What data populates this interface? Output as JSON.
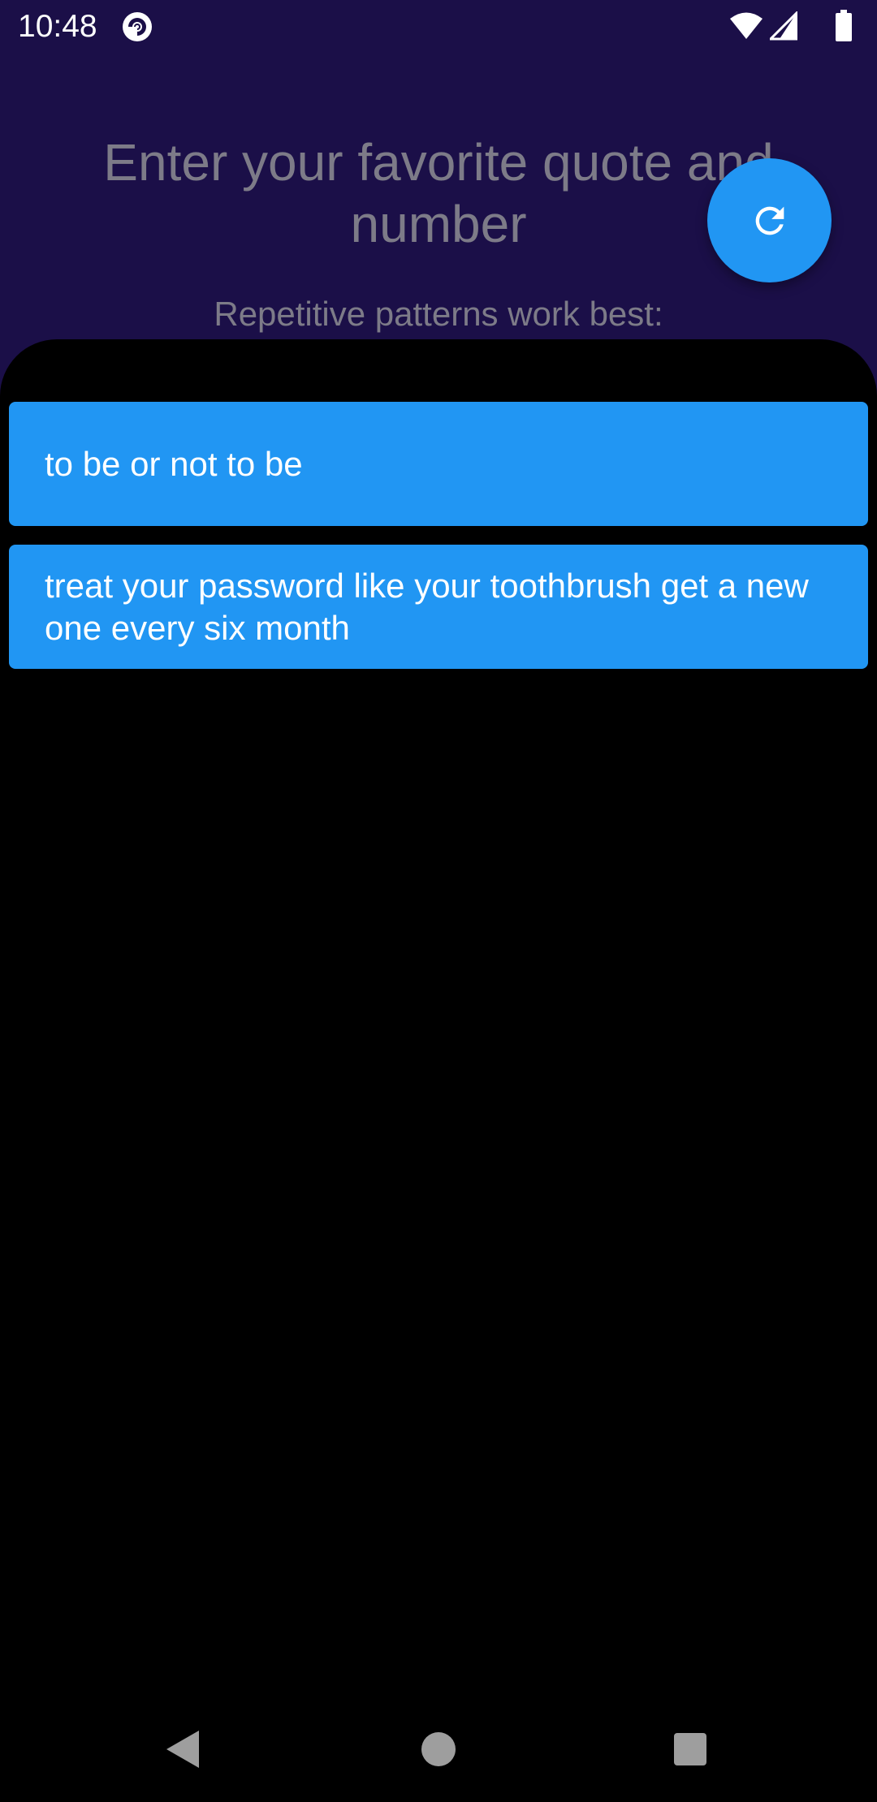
{
  "status_bar": {
    "time": "10:48",
    "app_icon": "pocket-casts-icon",
    "icons": [
      "wifi-icon",
      "cell-signal-icon",
      "battery-icon"
    ]
  },
  "header": {
    "title": "Enter your favorite quote and number",
    "subtitle": "Repetitive patterns work best:"
  },
  "fab": {
    "icon": "refresh-icon",
    "color": "#2196f3"
  },
  "quotes": [
    "to be or not to be",
    "treat your password like your toothbrush get a new one every six month"
  ],
  "nav_bar": {
    "icons": [
      "back-icon",
      "home-icon",
      "recents-icon"
    ]
  },
  "colors": {
    "background": "#1b0f48",
    "sheet": "#000000",
    "card": "#2196f3",
    "header_text": "#7d7b88"
  }
}
